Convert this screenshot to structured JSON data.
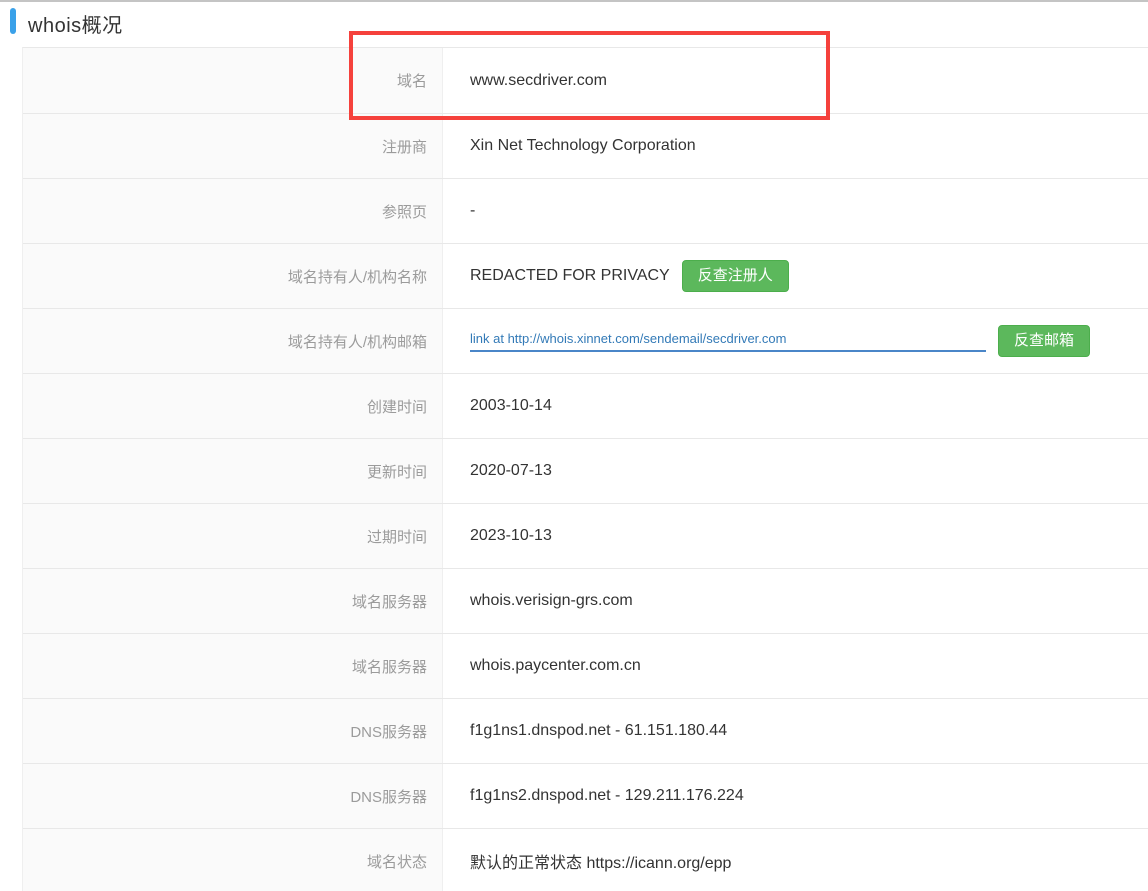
{
  "page": {
    "title": "whois概况"
  },
  "colors": {
    "accent_blue": "#3aa1e9",
    "button_green": "#5cb85c",
    "button_green_border": "#4cae4c",
    "link_blue": "#337ab7",
    "highlight_red": "#f5413c",
    "label_gray": "#9b9b9b",
    "value_dark": "#333333",
    "label_cell_bg": "#fafafa"
  },
  "annotation": {
    "highlighted_row_label": "域名",
    "highlighted_row_value": "www.secdriver.com"
  },
  "table": {
    "rows": [
      {
        "label": "域名",
        "value": "www.secdriver.com"
      },
      {
        "label": "注册商",
        "value": "Xin Net Technology Corporation"
      },
      {
        "label": "参照页",
        "value": "-"
      },
      {
        "label": "域名持有人/机构名称",
        "value": "REDACTED FOR PRIVACY",
        "button": "反查注册人",
        "button_name": "reverse-lookup-registrant-button"
      },
      {
        "label": "域名持有人/机构邮箱",
        "value": "link at http://whois.xinnet.com/sendemail/secdriver.com",
        "is_link": true,
        "button": "反查邮箱",
        "button_name": "reverse-lookup-email-button"
      },
      {
        "label": "创建时间",
        "value": "2003-10-14"
      },
      {
        "label": "更新时间",
        "value": "2020-07-13"
      },
      {
        "label": "过期时间",
        "value": "2023-10-13"
      },
      {
        "label": "域名服务器",
        "value": "whois.verisign-grs.com"
      },
      {
        "label": "域名服务器",
        "value": "whois.paycenter.com.cn"
      },
      {
        "label": "DNS服务器",
        "value": "f1g1ns1.dnspod.net - 61.151.180.44"
      },
      {
        "label": "DNS服务器",
        "value": "f1g1ns2.dnspod.net - 129.211.176.224"
      },
      {
        "label": "域名状态",
        "value": "默认的正常状态 https://icann.org/epp"
      }
    ]
  }
}
